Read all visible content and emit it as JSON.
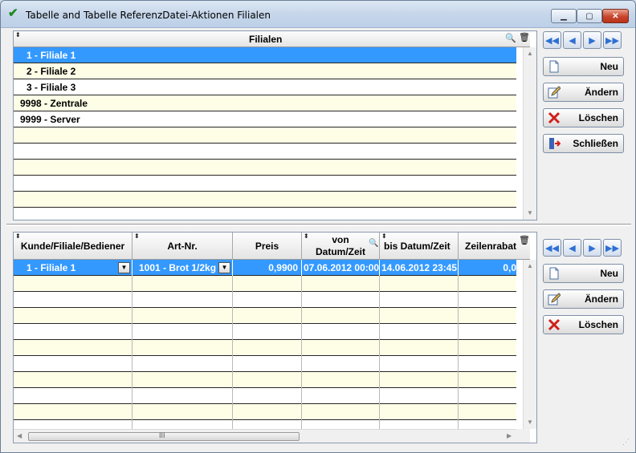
{
  "window": {
    "title": "Tabelle and Tabelle ReferenzDatei-Aktionen Filialen",
    "title_icon": "checkmark-icon"
  },
  "upper_grid": {
    "column_header": "Filialen",
    "rows": [
      {
        "label": "1 - Filiale 1",
        "selected": true
      },
      {
        "label": "2 - Filiale 2",
        "selected": false
      },
      {
        "label": "3 - Filiale 3",
        "selected": false
      },
      {
        "label": "9998 - Zentrale",
        "selected": false
      },
      {
        "label": "9999 - Server",
        "selected": false
      }
    ]
  },
  "lower_grid": {
    "columns": [
      "Kunde/Filiale/Bediener",
      "Art-Nr.",
      "Preis",
      "von Datum/Zeit",
      "bis Datum/Zeit",
      "Zeilenrabatt"
    ],
    "column_header_lines": {
      "von_line1": "von",
      "von_line2": "Datum/Zeit",
      "bis": "bis Datum/Zeit",
      "rabatt": "Zeilenrabat"
    },
    "rows": [
      {
        "kunde": "1 - Filiale 1",
        "artnr": "1001 - Brot 1/2kg",
        "preis": "0,9900",
        "von": "07.06.2012 00:00",
        "bis": "14.06.2012 23:45",
        "rabatt": "0,0"
      }
    ],
    "hscroll_text": "III"
  },
  "upper_actions": {
    "neu": "Neu",
    "aendern": "Ändern",
    "loeschen": "Löschen",
    "schliessen": "Schließen"
  },
  "lower_actions": {
    "neu": "Neu",
    "aendern": "Ändern",
    "loeschen": "Löschen"
  },
  "colors": {
    "selection": "#3399ff",
    "alt_row": "#fefde6",
    "nav_arrow": "#2e6fd3"
  }
}
